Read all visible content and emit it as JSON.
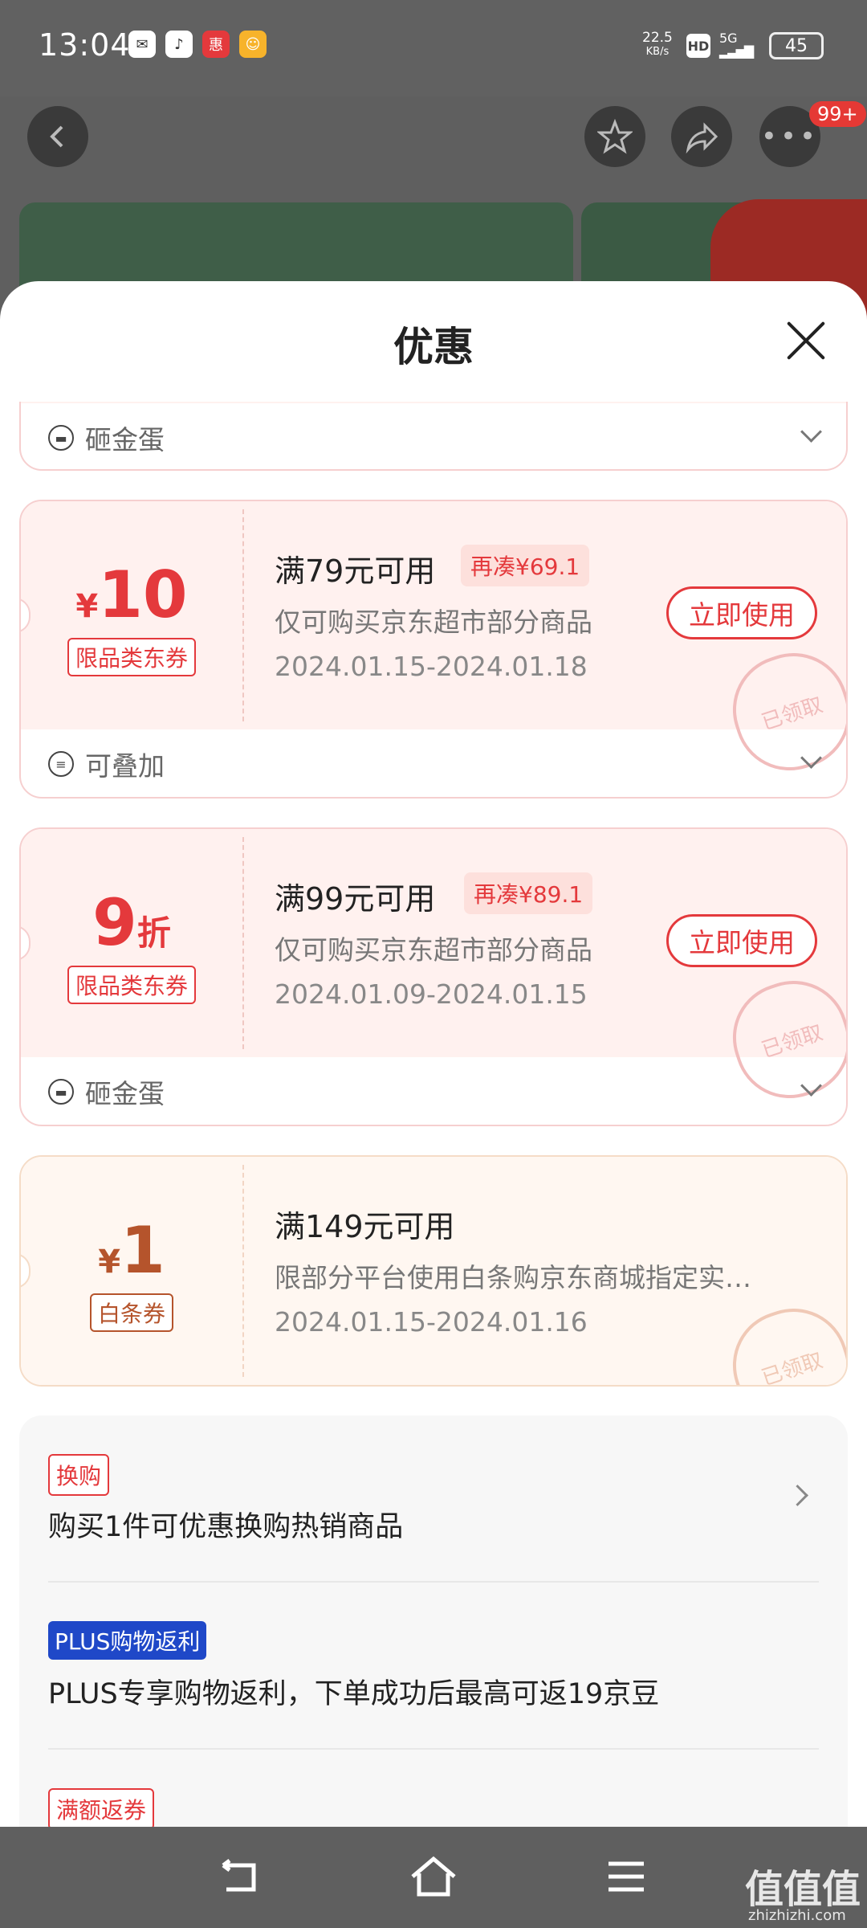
{
  "status_bar": {
    "time": "13:04",
    "net_speed": "22.5",
    "net_unit": "KB/s",
    "hd": "HD",
    "network": "5G",
    "battery": "45"
  },
  "header": {
    "more_badge": "99+"
  },
  "sheet": {
    "title": "优惠"
  },
  "top_partial_card": {
    "footer": "砸金蛋"
  },
  "coupons": [
    {
      "currency": "¥",
      "amount": "10",
      "suffix": "",
      "type": "限品类东券",
      "condition": "满79元可用",
      "extra": "再凑¥69.1",
      "desc": "仅可购买京东超市部分商品",
      "date": "2024.01.15-2024.01.18",
      "button": "立即使用",
      "stamp": "已领取",
      "footer": "可叠加"
    },
    {
      "currency": "",
      "amount": "9",
      "suffix": "折",
      "type": "限品类东券",
      "condition": "满99元可用",
      "extra": "再凑¥89.1",
      "desc": "仅可购买京东超市部分商品",
      "date": "2024.01.09-2024.01.15",
      "button": "立即使用",
      "stamp": "已领取",
      "footer": "砸金蛋"
    },
    {
      "currency": "¥",
      "amount": "1",
      "suffix": "",
      "type": "白条券",
      "condition": "满149元可用",
      "extra": "",
      "desc": "限部分平台使用白条购京东商城指定实…",
      "date": "2024.01.15-2024.01.16",
      "button": "",
      "stamp": "已领取",
      "footer": ""
    }
  ],
  "promos": [
    {
      "tag": "换购",
      "text": "购买1件可优惠换购热销商品"
    },
    {
      "tag": "PLUS购物返利",
      "text": "PLUS专享购物返利，下单成功后最高可返19京豆"
    },
    {
      "tag": "满额返券",
      "text": ""
    }
  ],
  "watermark": {
    "main": "值值值",
    "sub": "zhizhizhi.com"
  }
}
